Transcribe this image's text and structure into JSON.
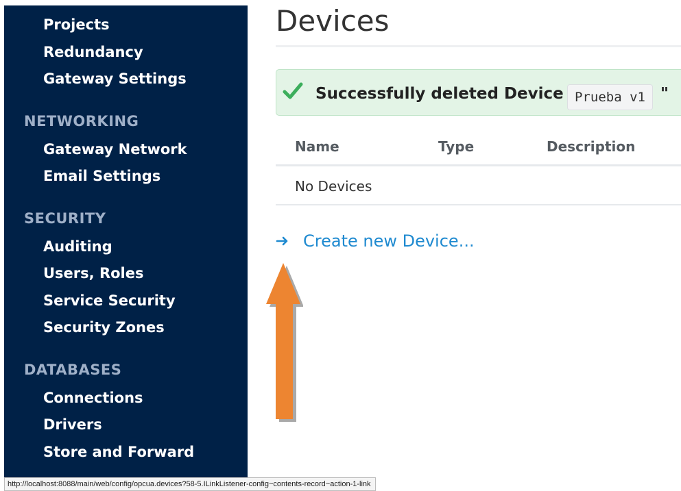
{
  "sidebar": {
    "top_items": [
      {
        "label": "Projects"
      },
      {
        "label": "Redundancy"
      },
      {
        "label": "Gateway Settings"
      }
    ],
    "sections": [
      {
        "heading": "NETWORKING",
        "items": [
          {
            "label": "Gateway Network"
          },
          {
            "label": "Email Settings"
          }
        ]
      },
      {
        "heading": "SECURITY",
        "items": [
          {
            "label": "Auditing"
          },
          {
            "label": "Users, Roles"
          },
          {
            "label": "Service Security"
          },
          {
            "label": "Security Zones"
          }
        ]
      },
      {
        "heading": "DATABASES",
        "items": [
          {
            "label": "Connections"
          },
          {
            "label": "Drivers"
          },
          {
            "label": "Store and Forward"
          }
        ]
      }
    ]
  },
  "main": {
    "title": "Devices",
    "alert": {
      "message": "Successfully deleted Device \"",
      "device_name": "Prueba v1",
      "closing_quote": "\"",
      "icon": "check-icon"
    },
    "table": {
      "columns": [
        "Name",
        "Type",
        "Description"
      ],
      "empty_text": "No Devices"
    },
    "create_link": {
      "label": "Create new Device...",
      "icon": "arrow-right-icon"
    }
  },
  "status_bar": {
    "url": "http://localhost:8088/main/web/config/opcua.devices?58-5.ILinkListener-config~contents-record~action-1-link"
  },
  "colors": {
    "sidebar_bg": "#002147",
    "section_heading": "#9fb0c8",
    "alert_bg": "#e3f4e6",
    "check_green": "#3cae5c",
    "link_blue": "#1f8ad0",
    "annotation_orange": "#ed8531"
  }
}
